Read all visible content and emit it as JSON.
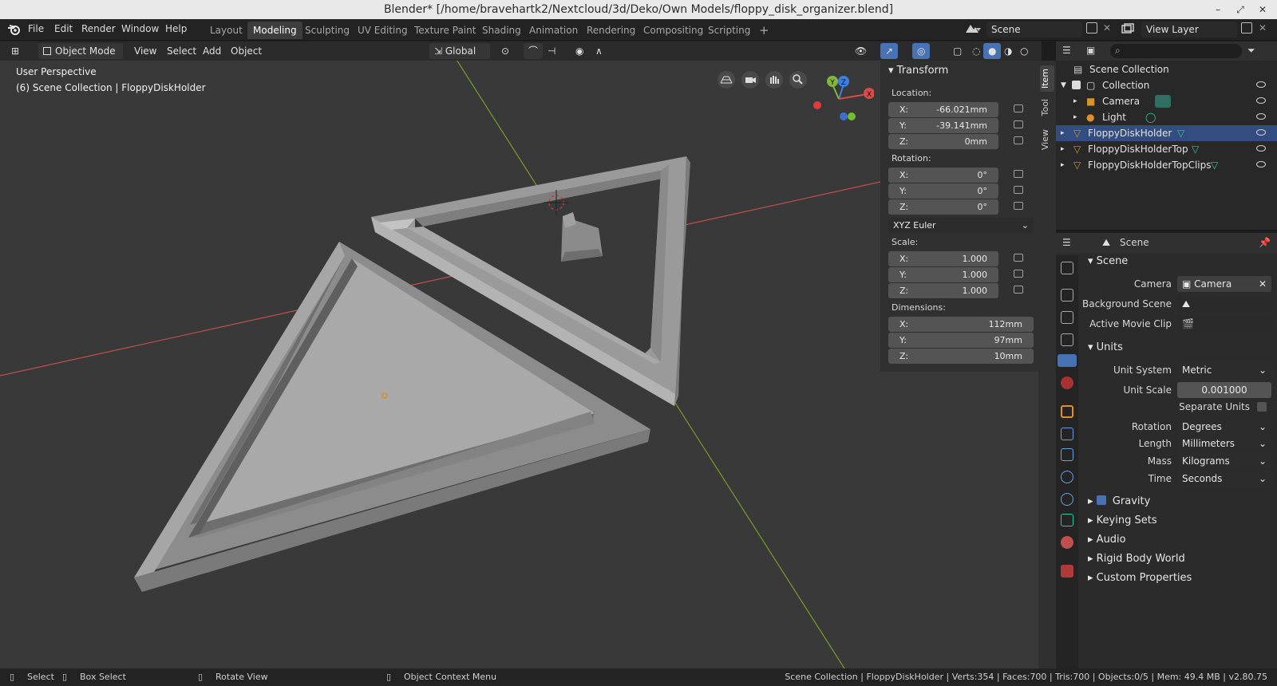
{
  "window": {
    "title": "Blender* [/home/bravehartk2/Nextcloud/3d/Deko/Own Models/floppy_disk_organizer.blend]",
    "minimize": "–",
    "maximize": "⤢",
    "close": "✕"
  },
  "menu": [
    "File",
    "Edit",
    "Render",
    "Window",
    "Help"
  ],
  "workspaces": {
    "tabs": [
      "Layout",
      "Modeling",
      "Sculpting",
      "UV Editing",
      "Texture Paint",
      "Shading",
      "Animation",
      "Rendering",
      "Compositing",
      "Scripting"
    ],
    "active": "Modeling",
    "add": "+"
  },
  "scene_selector": "Scene",
  "view_layer_selector": "View Layer",
  "viewport_header": {
    "mode": "Object Mode",
    "menus": [
      "View",
      "Select",
      "Add",
      "Object"
    ],
    "orientation": "Global"
  },
  "viewport": {
    "perspective": "User Perspective",
    "collection_info": "(6) Scene Collection | FloppyDiskHolder",
    "gizmo_axes": {
      "x": "X",
      "y": "Y",
      "z": "Z"
    }
  },
  "n_panel": {
    "section": "Transform",
    "location_label": "Location:",
    "location": [
      {
        "axis": "X:",
        "value": "-66.021mm"
      },
      {
        "axis": "Y:",
        "value": "-39.141mm"
      },
      {
        "axis": "Z:",
        "value": "0mm"
      }
    ],
    "rotation_label": "Rotation:",
    "rotation": [
      {
        "axis": "X:",
        "value": "0°"
      },
      {
        "axis": "Y:",
        "value": "0°"
      },
      {
        "axis": "Z:",
        "value": "0°"
      }
    ],
    "rotation_mode": "XYZ Euler",
    "scale_label": "Scale:",
    "scale": [
      {
        "axis": "X:",
        "value": "1.000"
      },
      {
        "axis": "Y:",
        "value": "1.000"
      },
      {
        "axis": "Z:",
        "value": "1.000"
      }
    ],
    "dimensions_label": "Dimensions:",
    "dimensions": [
      {
        "axis": "X:",
        "value": "112mm"
      },
      {
        "axis": "Y:",
        "value": "97mm"
      },
      {
        "axis": "Z:",
        "value": "10mm"
      }
    ]
  },
  "side_tabs": [
    "Item",
    "Tool",
    "View"
  ],
  "outliner": {
    "rows": [
      {
        "label": "Scene Collection",
        "icon": "scene-collection-icon",
        "selected": false
      },
      {
        "label": "Collection",
        "icon": "collection-icon",
        "selected": false
      },
      {
        "label": "Camera",
        "icon": "camera-icon",
        "selected": false
      },
      {
        "label": "Light",
        "icon": "light-icon",
        "selected": false
      },
      {
        "label": "FloppyDiskHolder",
        "icon": "mesh-icon",
        "selected": true
      },
      {
        "label": "FloppyDiskHolderTop",
        "icon": "mesh-icon",
        "selected": false
      },
      {
        "label": "FloppyDiskHolderTopClips",
        "icon": "mesh-icon",
        "selected": false
      }
    ]
  },
  "properties": {
    "context": "Scene",
    "scene_section": "Scene",
    "camera_label": "Camera",
    "camera_value": "Camera",
    "background_scene_label": "Background Scene",
    "active_movie_clip_label": "Active Movie Clip",
    "units_section": "Units",
    "unit_system_label": "Unit System",
    "unit_system": "Metric",
    "unit_scale_label": "Unit Scale",
    "unit_scale": "0.001000",
    "separate_units_label": "Separate Units",
    "rotation_label": "Rotation",
    "rotation": "Degrees",
    "length_label": "Length",
    "length": "Millimeters",
    "mass_label": "Mass",
    "mass": "Kilograms",
    "time_label": "Time",
    "time": "Seconds",
    "collapsed_sections": [
      "Gravity",
      "Keying Sets",
      "Audio",
      "Rigid Body World",
      "Custom Properties"
    ]
  },
  "statusbar": {
    "select": "Select",
    "box_select": "Box Select",
    "rotate_view": "Rotate View",
    "context_menu": "Object Context Menu",
    "stats": "Scene Collection | FloppyDiskHolder | Verts:354 | Faces:700 | Tris:700 | Objects:0/5 | Mem: 49.4 MB | v2.80.75"
  },
  "colors": {
    "selection": "#334d80",
    "axis_x": "#d94a4a",
    "axis_y": "#7fb83a",
    "axis_z": "#3b7fe0",
    "accent": "#4772b3"
  }
}
